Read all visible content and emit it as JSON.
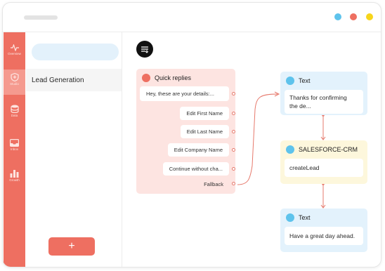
{
  "window": {
    "dots": [
      {
        "name": "blue",
        "color": "#5ec3ec"
      },
      {
        "name": "red",
        "color": "#ee6f61"
      },
      {
        "name": "yellow",
        "color": "#f7d51b"
      }
    ]
  },
  "sidebar": {
    "color": "#ee6f61",
    "items": [
      {
        "label": "Overview",
        "icon": "activity-icon"
      },
      {
        "label": "Studio",
        "icon": "shield-plus-icon",
        "active": true
      },
      {
        "label": "Data",
        "icon": "database-icon"
      },
      {
        "label": "Inbox",
        "icon": "inbox-icon"
      },
      {
        "label": "Growth",
        "icon": "bar-chart-icon"
      }
    ]
  },
  "panel": {
    "search_placeholder": "",
    "flows": [
      "Lead Generation"
    ],
    "add_label": "+"
  },
  "canvas": {
    "filter_icon": "filter-lines-icon",
    "quick_replies": {
      "title": "Quick replies",
      "message": "Hey, these are your details:...",
      "buttons": [
        "Edit First Name",
        "Edit Last Name",
        "Edit Company Name",
        "Continue without cha..."
      ],
      "fallback": "Fallback"
    },
    "nodes": [
      {
        "type": "Text",
        "content_lines": [
          "Thanks for confirming",
          "the de..."
        ]
      },
      {
        "type": "SALESFORCE-CRM",
        "content_lines": [
          "createLead"
        ]
      },
      {
        "type": "Text",
        "content_lines": [
          "Have a great day ahead."
        ]
      }
    ]
  }
}
